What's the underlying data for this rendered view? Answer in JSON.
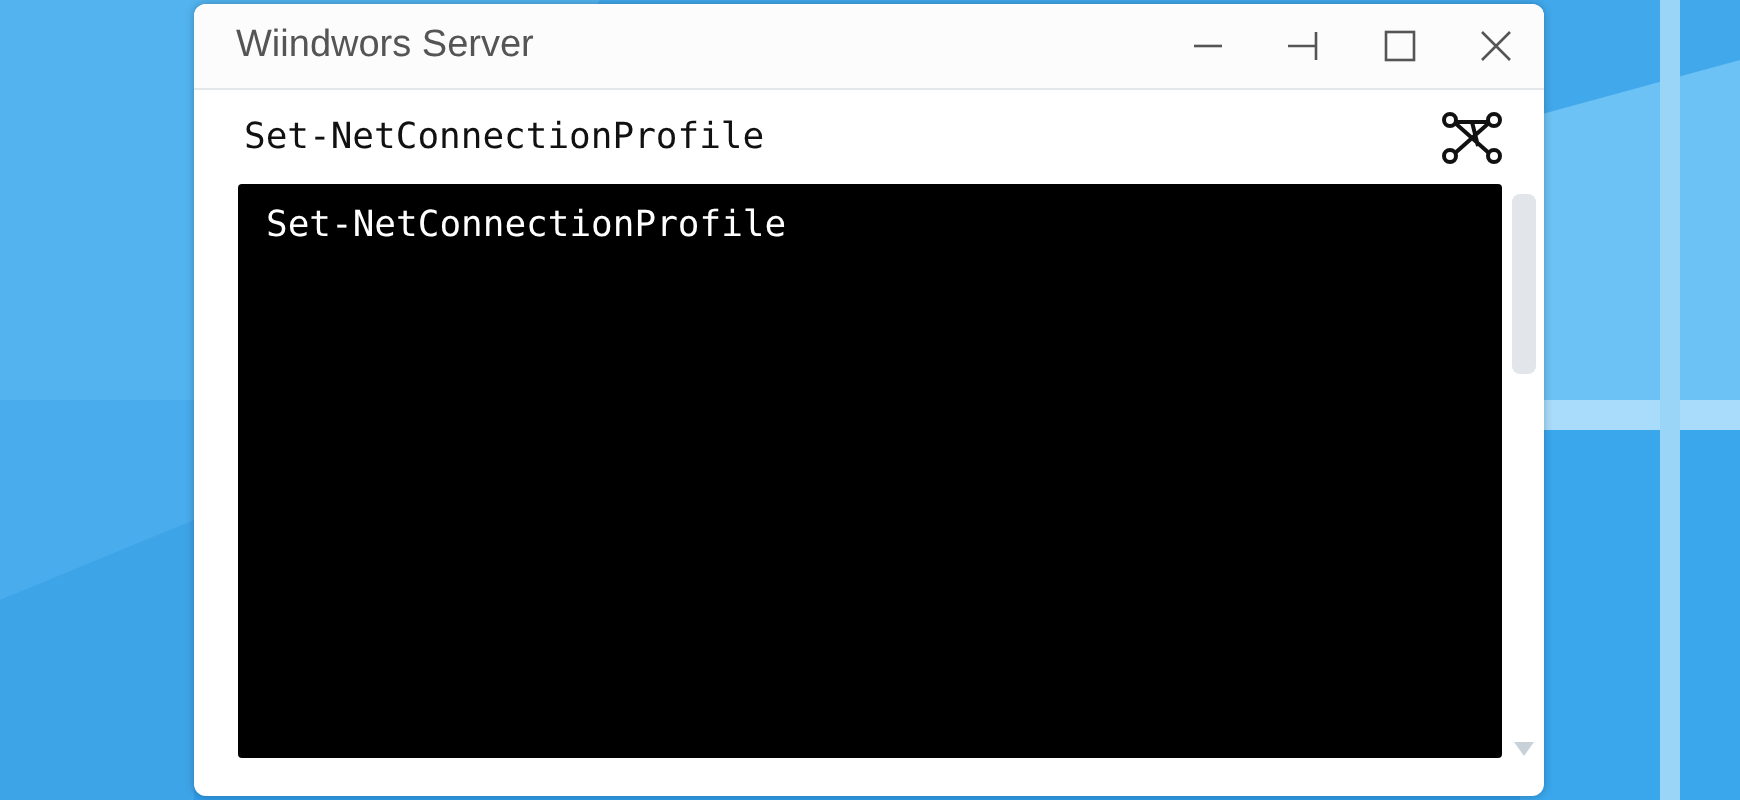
{
  "window": {
    "title": "Wiindwors Server"
  },
  "toolbar": {
    "command": "Set-NetConnectionProfile"
  },
  "console": {
    "lines": [
      "Set-NetConnectionProfile"
    ]
  }
}
